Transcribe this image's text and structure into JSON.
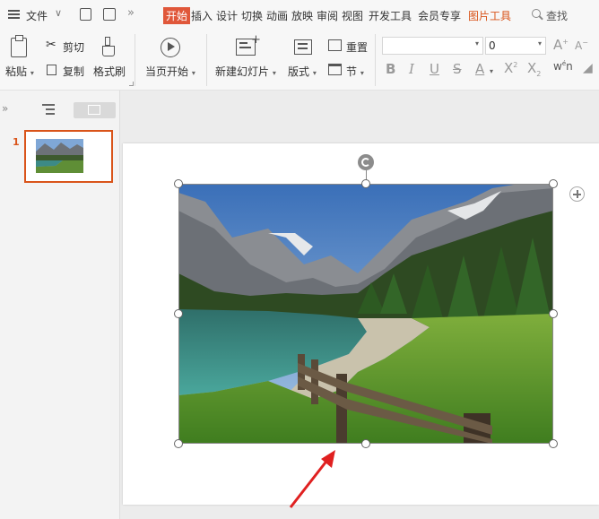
{
  "menu": {
    "file_label": "文件",
    "tabs": [
      "开始",
      "插入",
      "设计",
      "切换",
      "动画",
      "放映",
      "审阅",
      "视图",
      "开发工具",
      "会员专享",
      "图片工具"
    ],
    "search_label": "查找"
  },
  "ribbon": {
    "paste": "粘贴",
    "cut": "剪切",
    "copy": "复制",
    "format_painter": "格式刷",
    "from_current": "当页开始",
    "new_slide": "新建幻灯片",
    "layout": "版式",
    "section": "节",
    "reset": "重置",
    "font_size_value": "0"
  },
  "slides_panel": {
    "slide_number": "1"
  },
  "colors": {
    "accent_orange": "#e0573a",
    "tool_tab_orange": "#d9541a",
    "thumbnail_border": "#d9541a",
    "arrow_red": "#e02020"
  },
  "icons": {
    "menu": "hamburger-icon",
    "search": "magnifier-icon",
    "rotate": "rotate-icon",
    "add": "plus-circle-icon"
  }
}
